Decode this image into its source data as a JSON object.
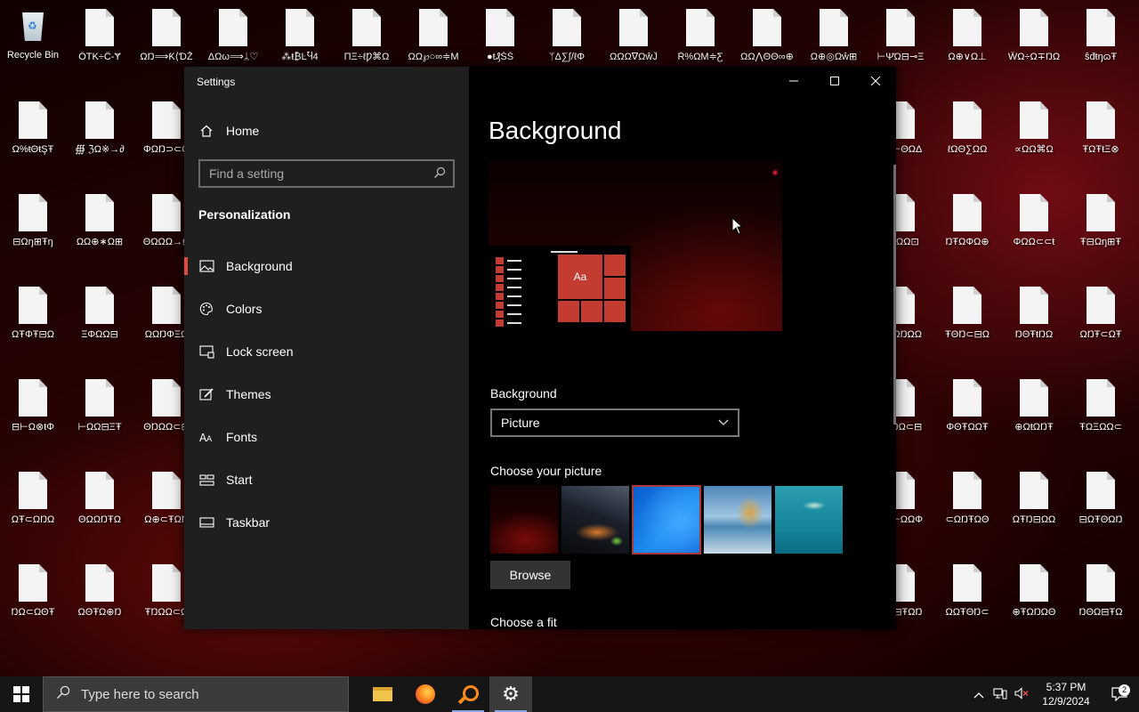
{
  "desktop": {
    "icons": [
      {
        "label": "Recycle Bin",
        "type": "recycle"
      },
      {
        "label": "ÖTK÷Ĉ-Ɏ",
        "type": "file"
      },
      {
        "label": "ΩŊ⟹Ƙ⟨ƊŽ",
        "type": "file"
      },
      {
        "label": "ΔΩω⟹ᛦ♡",
        "type": "file"
      },
      {
        "label": "⁂ŧ₿ĿႯ4",
        "type": "file"
      },
      {
        "label": "ΠΞ÷ℓǷ⌘Ω",
        "type": "file"
      },
      {
        "label": "ΩΩ℘○∞≑M",
        "type": "file"
      },
      {
        "label": "●ŧ₰ŠŠ",
        "type": "file"
      },
      {
        "label": "ᛘΔ∑∫/ℓΦ",
        "type": "file"
      },
      {
        "label": "ΩΩΩ∇ΩŵĴ",
        "type": "file"
      },
      {
        "label": "Ŕ%ΩΜ≑Ƹ",
        "type": "file"
      },
      {
        "label": "ΩΩ⋀ΘΘ∞⊕",
        "type": "file"
      },
      {
        "label": "Ω⊕◎Ωŵ⊞",
        "type": "file"
      },
      {
        "label": "⊢ΨΏ⊟⊸Ξ",
        "type": "file"
      },
      {
        "label": "Ω⊕∨Ω⊥",
        "type": "file"
      },
      {
        "label": "ŴΩ÷Ω∓ŊΩ",
        "type": "file"
      },
      {
        "label": "ŝđŧŋɷŦ",
        "type": "file"
      },
      {
        "label": "Ω%ŧΘŧŞŦ",
        "type": "file"
      },
      {
        "label": "∰ ℨΩ※→∂",
        "type": "file"
      },
      {
        "label": "ΦΩŊ⊃⊂Ϙ",
        "type": "file"
      },
      {
        "label": "ŦΩ⊢ΘΩΔ",
        "type": "file"
      },
      {
        "label": "ℓΩΘ∑ΩΩ",
        "type": "file"
      },
      {
        "label": "∝ΩΩ⌘Ω",
        "type": "file"
      },
      {
        "label": "ŦΩŦŧΞ⊗",
        "type": "file"
      },
      {
        "label": "⊟Ωŋ⊞Ŧŋ",
        "type": "file"
      },
      {
        "label": "ΩΩ⊕∗Ω⊞",
        "type": "file"
      },
      {
        "label": "ΘΩΩΩ→Ω",
        "type": "file"
      },
      {
        "label": "ΘΞΩΩ⊡",
        "type": "file"
      },
      {
        "label": "ŊŦΩΦΩ⊕",
        "type": "file"
      },
      {
        "label": "ΦΩΩ⊂⊂ŧ",
        "type": "file"
      },
      {
        "label": "Ŧ⊟Ωŋ⊞Ŧ",
        "type": "file"
      },
      {
        "label": "ΩŦΦŦ⊟Ω",
        "type": "file"
      },
      {
        "label": "ΞΦΩΩ⊟",
        "type": "file"
      },
      {
        "label": "ΩΩŊΦΞΩ",
        "type": "file"
      },
      {
        "label": "∓ŋΩŊΩΩ",
        "type": "file"
      },
      {
        "label": "ŦΘŊ⊂⊟Ω",
        "type": "file"
      },
      {
        "label": "ŊΘŦŧŊΩ",
        "type": "file"
      },
      {
        "label": "ΩŊŦ⊂ΩŦ",
        "type": "file"
      },
      {
        "label": "⊟⊢Ω⊗ŧΦ",
        "type": "file"
      },
      {
        "label": "⊢ΩΩ⊟ΞŦ",
        "type": "file"
      },
      {
        "label": "ΘŊΩΩ⊂⊟",
        "type": "file"
      },
      {
        "label": "ΞŦŊΩ⊂⊟",
        "type": "file"
      },
      {
        "label": "ΦΘŦΩΩŦ",
        "type": "file"
      },
      {
        "label": "⊕ΩŧΩŊŦ",
        "type": "file"
      },
      {
        "label": "ŦΩΞΩΩ⊂",
        "type": "file"
      },
      {
        "label": "ΩŦ⊂ΩŊΩ",
        "type": "file"
      },
      {
        "label": "ΘΩΩŊŦΩ",
        "type": "file"
      },
      {
        "label": "Ω⊕⊂ŦΩŊ",
        "type": "file"
      },
      {
        "label": "ŦΘ⊢ΩΩΦ",
        "type": "file"
      },
      {
        "label": "⊂ΩŊŦΩΘ",
        "type": "file"
      },
      {
        "label": "ΩŦŊ⊟ΩΩ",
        "type": "file"
      },
      {
        "label": "⊟ΩŦΘΩŊ",
        "type": "file"
      },
      {
        "label": "ŊΩ⊂ΩΘŦ",
        "type": "file"
      },
      {
        "label": "ΩΘŦΩ⊕Ŋ",
        "type": "file"
      },
      {
        "label": "ŦŊΩΩ⊂Ω",
        "type": "file"
      },
      {
        "label": "ΘΩ⊟ŦΩŊ",
        "type": "file"
      },
      {
        "label": "ΩΩŦΘŊ⊂",
        "type": "file"
      },
      {
        "label": "⊕ŦΩŊΩΘ",
        "type": "file"
      },
      {
        "label": "ŊΘΩ⊟ŦΩ",
        "type": "file"
      },
      {
        "label": "ΩŊ⊕ΘΩŦ",
        "type": "file"
      }
    ]
  },
  "settings": {
    "window_title": "Settings",
    "nav": {
      "home_label": "Home",
      "search_placeholder": "Find a setting",
      "section_title": "Personalization",
      "items": [
        {
          "label": "Background",
          "icon": "picture-icon",
          "active": true
        },
        {
          "label": "Colors",
          "icon": "palette-icon",
          "active": false
        },
        {
          "label": "Lock screen",
          "icon": "lock-screen-icon",
          "active": false
        },
        {
          "label": "Themes",
          "icon": "themes-icon",
          "active": false
        },
        {
          "label": "Fonts",
          "icon": "fonts-icon",
          "active": false
        },
        {
          "label": "Start",
          "icon": "start-icon",
          "active": false
        },
        {
          "label": "Taskbar",
          "icon": "taskbar-icon",
          "active": false
        }
      ]
    },
    "content": {
      "page_title": "Background",
      "preview_tile_text": "Aa",
      "background_label": "Background",
      "background_value": "Picture",
      "choose_picture_label": "Choose your picture",
      "browse_label": "Browse",
      "choose_fit_label": "Choose a fit",
      "thumbnails": [
        {
          "name": "red-abstract",
          "selected": false
        },
        {
          "name": "night-sky-tent",
          "selected": false
        },
        {
          "name": "windows-blue",
          "selected": true
        },
        {
          "name": "beach-rocks",
          "selected": false
        },
        {
          "name": "underwater-swimmer",
          "selected": false
        }
      ]
    }
  },
  "taskbar": {
    "search_placeholder": "Type here to search",
    "time": "5:37 PM",
    "date": "12/9/2024",
    "notification_count": "2"
  }
}
